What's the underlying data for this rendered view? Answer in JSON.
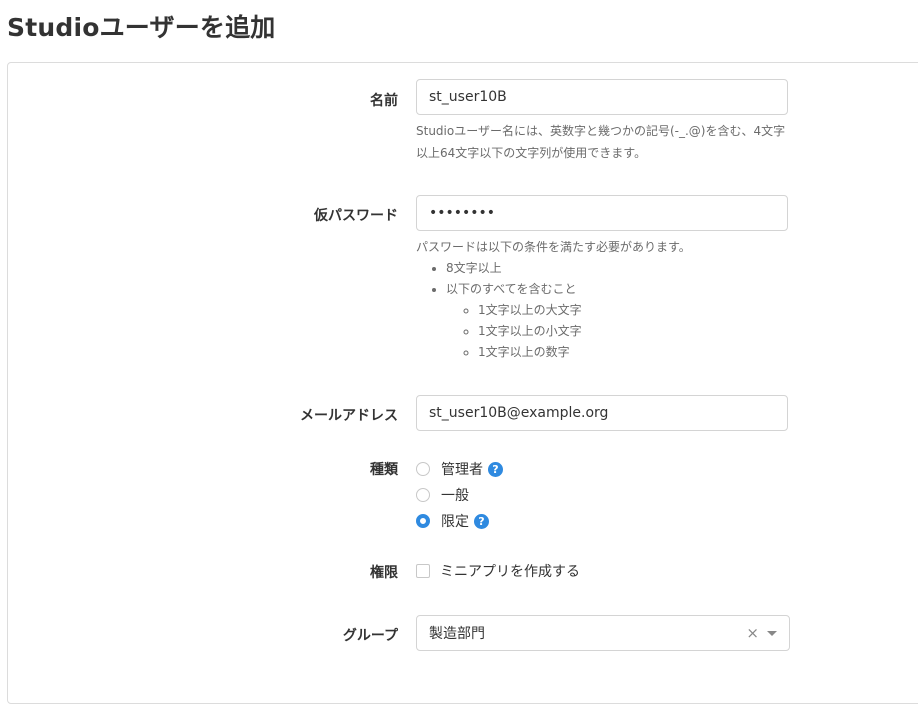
{
  "page": {
    "title": "Studioユーザーを追加"
  },
  "form": {
    "name": {
      "label": "名前",
      "value": "st_user10B",
      "help_line1": "Studioユーザー名には、英数字と幾つかの記号(-_.@)を含む、4文字",
      "help_line2": "以上64文字以下の文字列が使用できます。"
    },
    "password": {
      "label": "仮パスワード",
      "value": "••••••••",
      "help_intro": "パスワードは以下の条件を満たす必要があります。",
      "rules": [
        "8文字以上",
        "以下のすべてを含むこと"
      ],
      "sub_rules": [
        "1文字以上の大文字",
        "1文字以上の小文字",
        "1文字以上の数字"
      ]
    },
    "email": {
      "label": "メールアドレス",
      "value": "st_user10B@example.org"
    },
    "type": {
      "label": "種類",
      "options": [
        {
          "label": "管理者",
          "checked": false,
          "has_help": true
        },
        {
          "label": "一般",
          "checked": false,
          "has_help": false
        },
        {
          "label": "限定",
          "checked": true,
          "has_help": true
        }
      ],
      "help_glyph": "?"
    },
    "permission": {
      "label": "権限",
      "checkbox_label": "ミニアプリを作成する",
      "checked": false
    },
    "group": {
      "label": "グループ",
      "value": "製造部門",
      "clear_glyph": "×"
    }
  },
  "colors": {
    "accent": "#2f8ae0",
    "border": "#d4d4d4",
    "help_text": "#6b6b6b"
  }
}
